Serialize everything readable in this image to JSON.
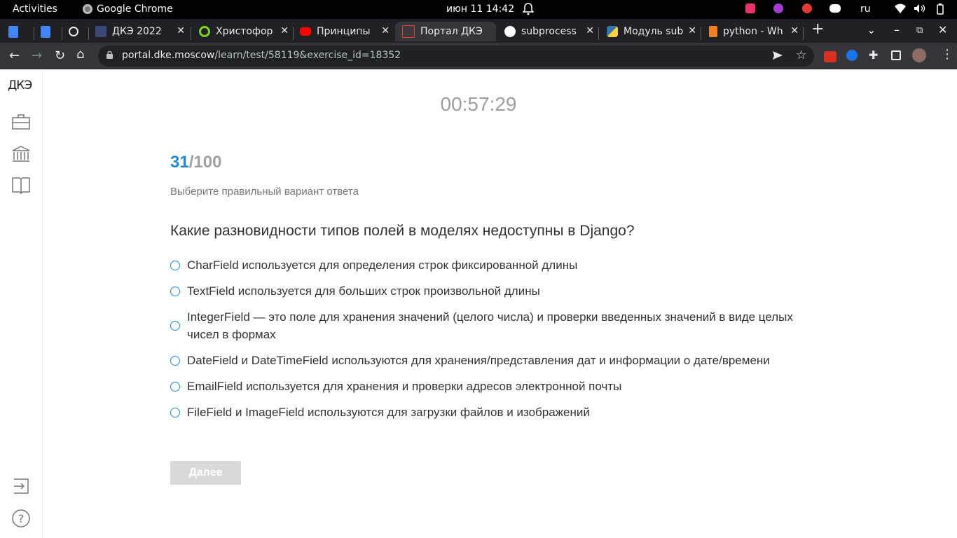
{
  "system_bar": {
    "activities": "Activities",
    "app_name": "Google Chrome",
    "clock": "июн 11  14:42",
    "keyboard_layout": "ru"
  },
  "tabs": [
    {
      "title": "",
      "icon": "google-docs-icon"
    },
    {
      "title": "",
      "icon": "google-docs-icon"
    },
    {
      "title": "",
      "icon": "link-icon"
    },
    {
      "title": "ДКЭ 2022",
      "icon": "dke-icon"
    },
    {
      "title": "Христофор",
      "icon": "green-ring-icon"
    },
    {
      "title": "Принципы",
      "icon": "youtube-icon"
    },
    {
      "title": "Портал ДКЭ",
      "icon": "dke-icon",
      "active": true
    },
    {
      "title": "subprocess",
      "icon": "google-icon"
    },
    {
      "title": "Модуль sub",
      "icon": "python-icon"
    },
    {
      "title": "python - Wh",
      "icon": "stackoverflow-icon"
    }
  ],
  "toolbar": {
    "url_host": "portal.dke.moscow",
    "url_path": "/learn/test/58119&exercise_id=18352"
  },
  "rail": {
    "logo": "ДКЭ",
    "items": [
      "briefcase-icon",
      "institution-icon",
      "book-icon"
    ],
    "bottom": [
      "logout-icon",
      "help-icon"
    ]
  },
  "test": {
    "timer": "00:57:29",
    "current": "31",
    "total": "/100",
    "instruction": "Выберите правильный вариант ответа",
    "question": "Какие разновидности типов полей в моделях недоступны в Django?",
    "answers": [
      "CharField используется для определения строк фиксированной длины",
      "TextField используется для больших строк произвольной длины",
      "IntegerField — это поле для хранения значений (целого числа) и проверки введенных значений в виде целых чисел в формах",
      "DateField и DateTimeField используются для хранения/представления дат и информации о дате/времени",
      "EmailField используется для хранения и проверки адресов электронной почты",
      "FileField и ImageField используются для загрузки файлов и изображений"
    ],
    "next_label": "Далее"
  },
  "colors": {
    "accent": "#1e8ad6",
    "button_disabled": "#d9d9d9",
    "tabstrip": "#202124",
    "toolbar": "#35363a"
  }
}
